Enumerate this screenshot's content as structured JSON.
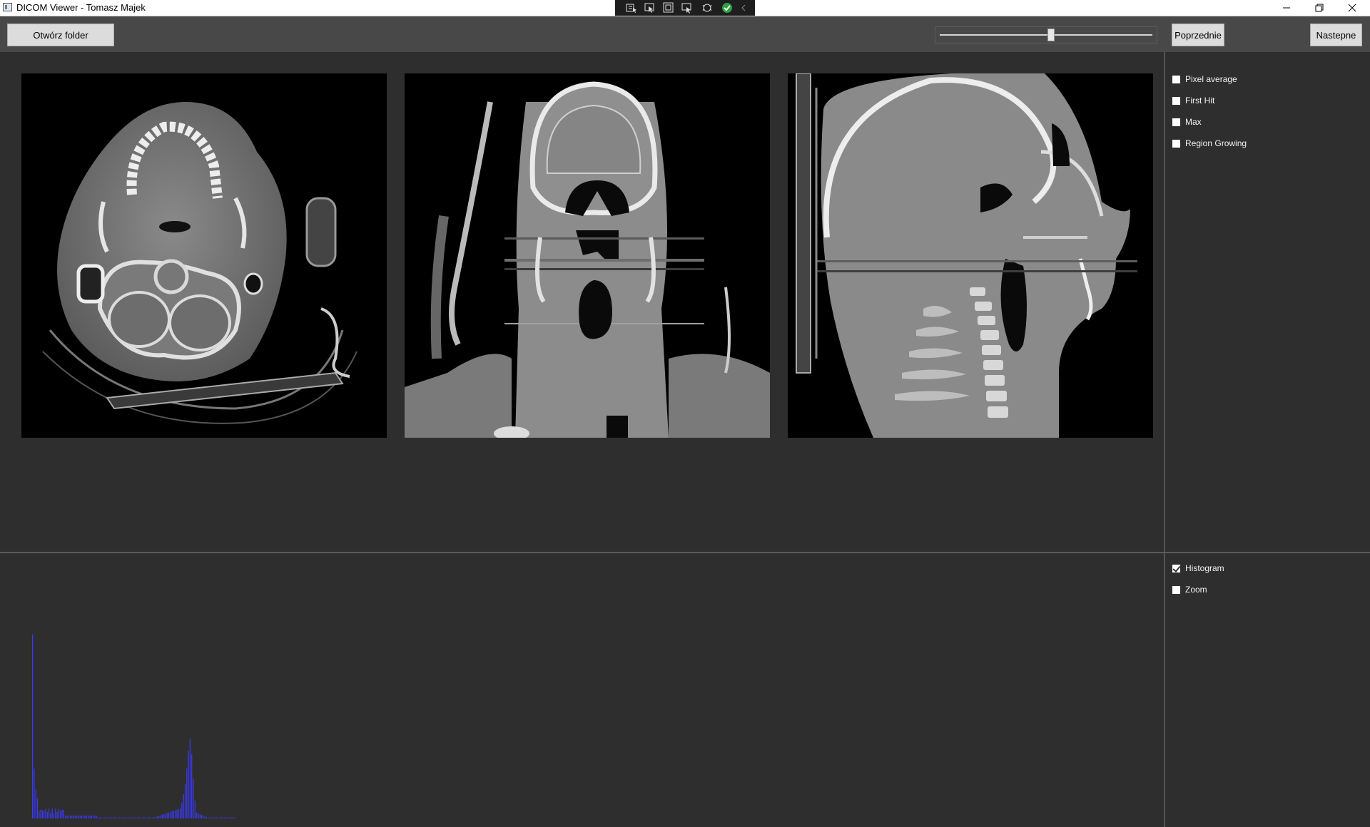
{
  "window": {
    "title": "DICOM Viewer - Tomasz Majek"
  },
  "toolbar": {
    "open_folder_label": "Otwórz folder",
    "prev_label": "Poprzednie",
    "next_label": "Nastepne",
    "slice_slider_value": 0.52
  },
  "render_options": [
    {
      "label": "Pixel average",
      "checked": false
    },
    {
      "label": "First Hit",
      "checked": false
    },
    {
      "label": "Max",
      "checked": false
    },
    {
      "label": "Region Growing",
      "checked": false
    }
  ],
  "view_options": [
    {
      "label": "Histogram",
      "checked": true
    },
    {
      "label": "Zoom",
      "checked": false
    }
  ],
  "views": [
    "axial",
    "coronal",
    "sagittal"
  ],
  "colors": {
    "histogram_bar": "#3a3aff",
    "background": "#2e2e2e",
    "toolbar": "#484848"
  }
}
